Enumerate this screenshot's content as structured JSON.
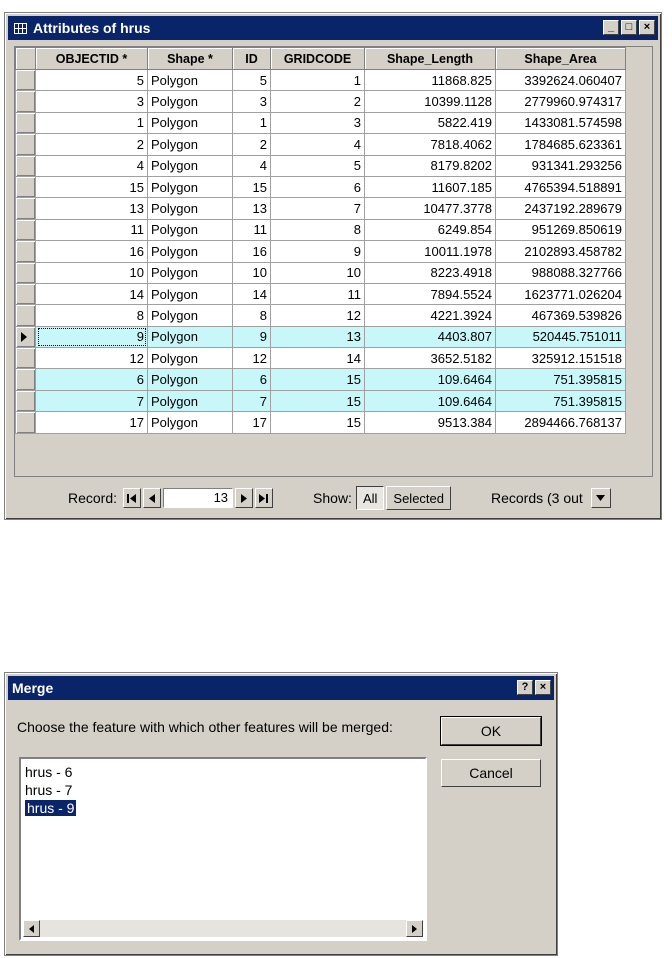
{
  "table_window": {
    "title": "Attributes of hrus",
    "buttons": {
      "minimize": "_",
      "maximize": "□",
      "close": "×"
    },
    "columns": [
      "OBJECTID *",
      "Shape *",
      "ID",
      "GRIDCODE",
      "Shape_Length",
      "Shape_Area"
    ],
    "rows": [
      {
        "objectid": "5",
        "shape": "Polygon",
        "id": "5",
        "gridcode": "1",
        "length": "11868.825",
        "area": "3392624.060407",
        "selected": false
      },
      {
        "objectid": "3",
        "shape": "Polygon",
        "id": "3",
        "gridcode": "2",
        "length": "10399.1128",
        "area": "2779960.974317",
        "selected": false
      },
      {
        "objectid": "1",
        "shape": "Polygon",
        "id": "1",
        "gridcode": "3",
        "length": "5822.419",
        "area": "1433081.574598",
        "selected": false
      },
      {
        "objectid": "2",
        "shape": "Polygon",
        "id": "2",
        "gridcode": "4",
        "length": "7818.4062",
        "area": "1784685.623361",
        "selected": false
      },
      {
        "objectid": "4",
        "shape": "Polygon",
        "id": "4",
        "gridcode": "5",
        "length": "8179.8202",
        "area": "931341.293256",
        "selected": false
      },
      {
        "objectid": "15",
        "shape": "Polygon",
        "id": "15",
        "gridcode": "6",
        "length": "11607.185",
        "area": "4765394.518891",
        "selected": false
      },
      {
        "objectid": "13",
        "shape": "Polygon",
        "id": "13",
        "gridcode": "7",
        "length": "10477.3778",
        "area": "2437192.289679",
        "selected": false
      },
      {
        "objectid": "11",
        "shape": "Polygon",
        "id": "11",
        "gridcode": "8",
        "length": "6249.854",
        "area": "951269.850619",
        "selected": false
      },
      {
        "objectid": "16",
        "shape": "Polygon",
        "id": "16",
        "gridcode": "9",
        "length": "10011.1978",
        "area": "2102893.458782",
        "selected": false
      },
      {
        "objectid": "10",
        "shape": "Polygon",
        "id": "10",
        "gridcode": "10",
        "length": "8223.4918",
        "area": "988088.327766",
        "selected": false
      },
      {
        "objectid": "14",
        "shape": "Polygon",
        "id": "14",
        "gridcode": "11",
        "length": "7894.5524",
        "area": "1623771.026204",
        "selected": false
      },
      {
        "objectid": "8",
        "shape": "Polygon",
        "id": "8",
        "gridcode": "12",
        "length": "4221.3924",
        "area": "467369.539826",
        "selected": false
      },
      {
        "objectid": "9",
        "shape": "Polygon",
        "id": "9",
        "gridcode": "13",
        "length": "4403.807",
        "area": "520445.751011",
        "selected": true,
        "current": true
      },
      {
        "objectid": "12",
        "shape": "Polygon",
        "id": "12",
        "gridcode": "14",
        "length": "3652.5182",
        "area": "325912.151518",
        "selected": false
      },
      {
        "objectid": "6",
        "shape": "Polygon",
        "id": "6",
        "gridcode": "15",
        "length": "109.6464",
        "area": "751.395815",
        "selected": true
      },
      {
        "objectid": "7",
        "shape": "Polygon",
        "id": "7",
        "gridcode": "15",
        "length": "109.6464",
        "area": "751.395815",
        "selected": true
      },
      {
        "objectid": "17",
        "shape": "Polygon",
        "id": "17",
        "gridcode": "15",
        "length": "9513.384",
        "area": "2894466.768137",
        "selected": false
      }
    ],
    "record_bar": {
      "record_label": "Record:",
      "record_value": "13",
      "show_label": "Show:",
      "show_all": "All",
      "show_selected": "Selected",
      "records_text": "Records (3 out"
    },
    "selected_color": "#c8f7fa"
  },
  "merge_dialog": {
    "title": "Merge",
    "help_button": "?",
    "close_button": "×",
    "prompt": "Choose the feature with which other features will be merged:",
    "items": [
      "hrus - 6",
      "hrus - 7",
      "hrus - 9"
    ],
    "selected_index": 2,
    "ok_label": "OK",
    "cancel_label": "Cancel"
  }
}
